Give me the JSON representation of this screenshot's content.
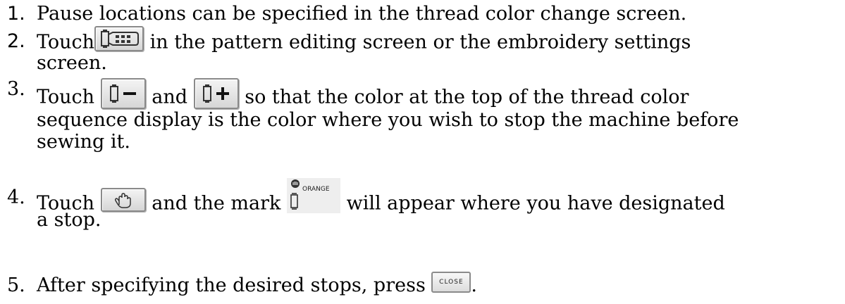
{
  "steps": [
    {
      "number": "1.",
      "text": "Pause locations can be specified in the thread color change screen."
    },
    {
      "number": "2.",
      "before": "Touch",
      "after": "in the pattern editing screen or the embroidery settings",
      "cont": "screen."
    },
    {
      "number": "3.",
      "before": "Touch",
      "mid": "and",
      "after": "so that the color at the top of the thread color",
      "cont1": "sequence display is the color where you wish to stop the machine before",
      "cont2": "sewing it."
    },
    {
      "number": "4.",
      "before": "Touch",
      "mid": "and the mark",
      "after": "will appear where you have designated",
      "cont": "a stop."
    },
    {
      "number": "5.",
      "before": "After specifying the desired stops, press",
      "after": "."
    }
  ],
  "icons": {
    "thread_color_button": "thread-color-change-icon",
    "minus_button": "thread-minus-icon",
    "plus_button": "thread-plus-icon",
    "pause_button": "hand-stop-icon",
    "pause_mark": "pause-mark-icon",
    "close_button": "close-button"
  },
  "pause_mark_label": "ORANGE",
  "close_label": "CLOSE"
}
